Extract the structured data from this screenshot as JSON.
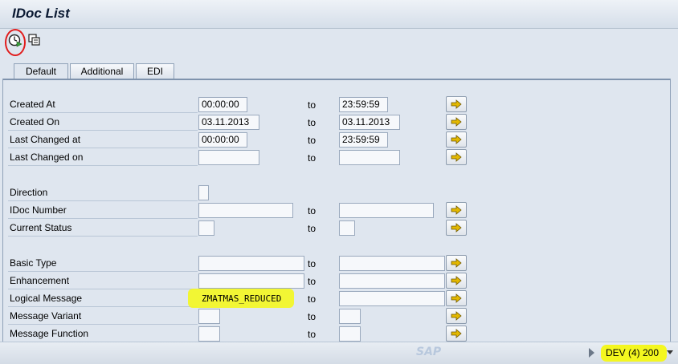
{
  "window": {
    "title": "IDoc List"
  },
  "toolbar": {
    "execute_icon": "execute-clock-icon",
    "variant_icon": "get-variant-icon"
  },
  "tabs": [
    {
      "label": "Default",
      "active": true
    },
    {
      "label": "Additional",
      "active": false
    },
    {
      "label": "EDI",
      "active": false
    }
  ],
  "form": {
    "to_label": "to",
    "rows": [
      {
        "label": "Created At",
        "from": "00:00:00",
        "to": "23:59:59"
      },
      {
        "label": "Created On",
        "from": "03.11.2013",
        "to": "03.11.2013"
      },
      {
        "label": "Last Changed at",
        "from": "00:00:00",
        "to": "23:59:59"
      },
      {
        "label": "Last Changed on",
        "from": "",
        "to": ""
      },
      {
        "label": "Direction",
        "from": ""
      },
      {
        "label": "IDoc Number",
        "from": "",
        "to": ""
      },
      {
        "label": "Current Status",
        "from": "",
        "to": ""
      },
      {
        "label": "Basic Type",
        "from": "",
        "to": ""
      },
      {
        "label": "Enhancement",
        "from": "",
        "to": ""
      },
      {
        "label": "Logical Message",
        "from": "ZMATMAS_REDUCED",
        "to": ""
      },
      {
        "label": "Message Variant",
        "from": "",
        "to": ""
      },
      {
        "label": "Message Function",
        "from": "",
        "to": ""
      }
    ]
  },
  "status": {
    "logo": "SAP",
    "system": "DEV (4) 200"
  },
  "colors": {
    "highlight": "#f4f71f",
    "annotation": "#e11d1d",
    "multi_select_arrow": "#e3b800"
  }
}
